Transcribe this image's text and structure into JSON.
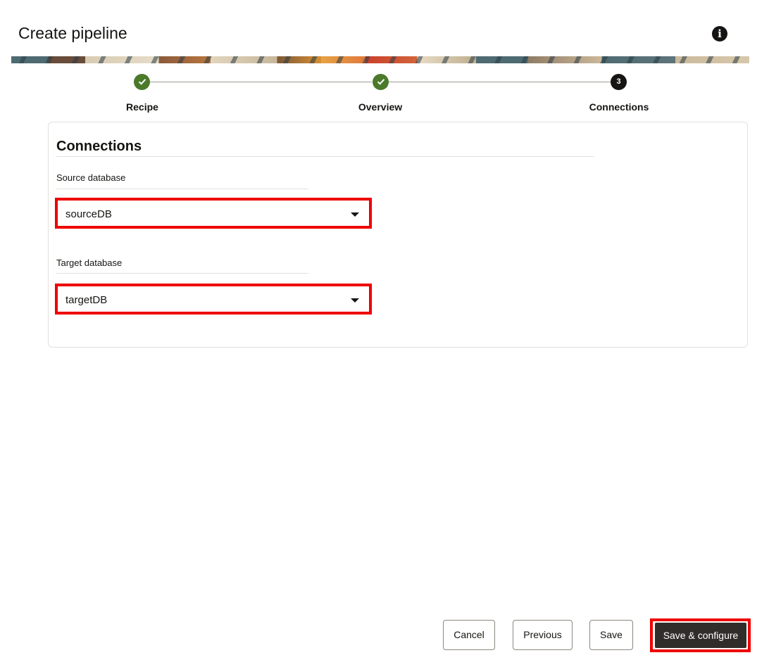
{
  "dialog": {
    "title": "Create pipeline",
    "info_icon": "info-icon",
    "info_glyph": "i"
  },
  "stepper": {
    "steps": [
      {
        "label": "Recipe",
        "status": "complete",
        "icon": "check-icon"
      },
      {
        "label": "Overview",
        "status": "complete",
        "icon": "check-icon"
      },
      {
        "label": "Connections",
        "status": "current",
        "number": "3"
      }
    ],
    "complete_color": "#4a7a2a",
    "current_color": "#161513"
  },
  "connections": {
    "title": "Connections",
    "source": {
      "label": "Source database",
      "value": "sourceDB",
      "icon": "caret-down-icon"
    },
    "target": {
      "label": "Target database",
      "value": "targetDB",
      "icon": "caret-down-icon"
    },
    "highlight_color": "#ee0000"
  },
  "footer": {
    "cancel_label": "Cancel",
    "previous_label": "Previous",
    "save_label": "Save",
    "save_configure_label": "Save & configure",
    "primary_color": "#312d2a"
  }
}
